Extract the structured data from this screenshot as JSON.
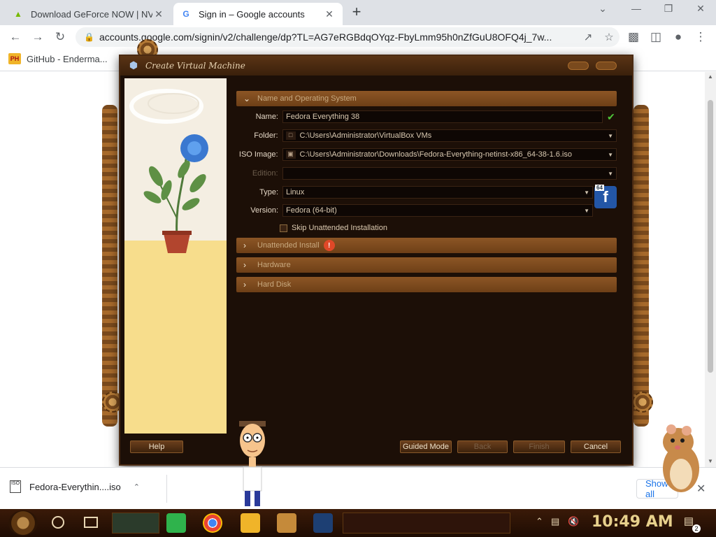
{
  "browser": {
    "tabs": [
      {
        "title": "Download GeForce NOW | NVI",
        "favicon": "nvidia-icon",
        "color": "#76b900"
      },
      {
        "title": "Sign in – Google accounts",
        "favicon": "google-icon",
        "color": "#4285f4"
      }
    ],
    "url": "accounts.google.com/signin/v2/challenge/dp?TL=AG7eRGBdqOYqz-FbyLmm95h0nZfGuU8OFQ4j_7w...",
    "bookmark": {
      "label": "GitHub - Enderma...",
      "icon_text": "PH"
    }
  },
  "dialog": {
    "title": "Create Virtual Machine",
    "sections": {
      "name_os": "Name and Operating System",
      "unattended": "Unattended Install",
      "hardware": "Hardware",
      "hard_disk": "Hard Disk"
    },
    "fields": {
      "name_label": "Name:",
      "name_value": "Fedora Everything 38",
      "folder_label": "Folder:",
      "folder_value": "C:\\Users\\Administrator\\VirtualBox VMs",
      "iso_label": "ISO Image:",
      "iso_value": "C:\\Users\\Administrator\\Downloads\\Fedora-Everything-netinst-x86_64-38-1.6.iso",
      "edition_label": "Edition:",
      "edition_value": "",
      "type_label": "Type:",
      "type_value": "Linux",
      "version_label": "Version:",
      "version_value": "Fedora (64-bit)",
      "os_badge_bits": "64",
      "os_badge_letter": "f"
    },
    "skip_unattended": {
      "label": "Skip Unattended Installation",
      "checked": false
    },
    "buttons": {
      "help": "Help",
      "guided": "Guided Mode",
      "back": "Back",
      "finish": "Finish",
      "cancel": "Cancel"
    }
  },
  "downloads": {
    "item": "Fedora-Everythin....iso",
    "show_all": "Show all"
  },
  "taskbar": {
    "clock": "10:49 AM",
    "notifications": "2"
  }
}
